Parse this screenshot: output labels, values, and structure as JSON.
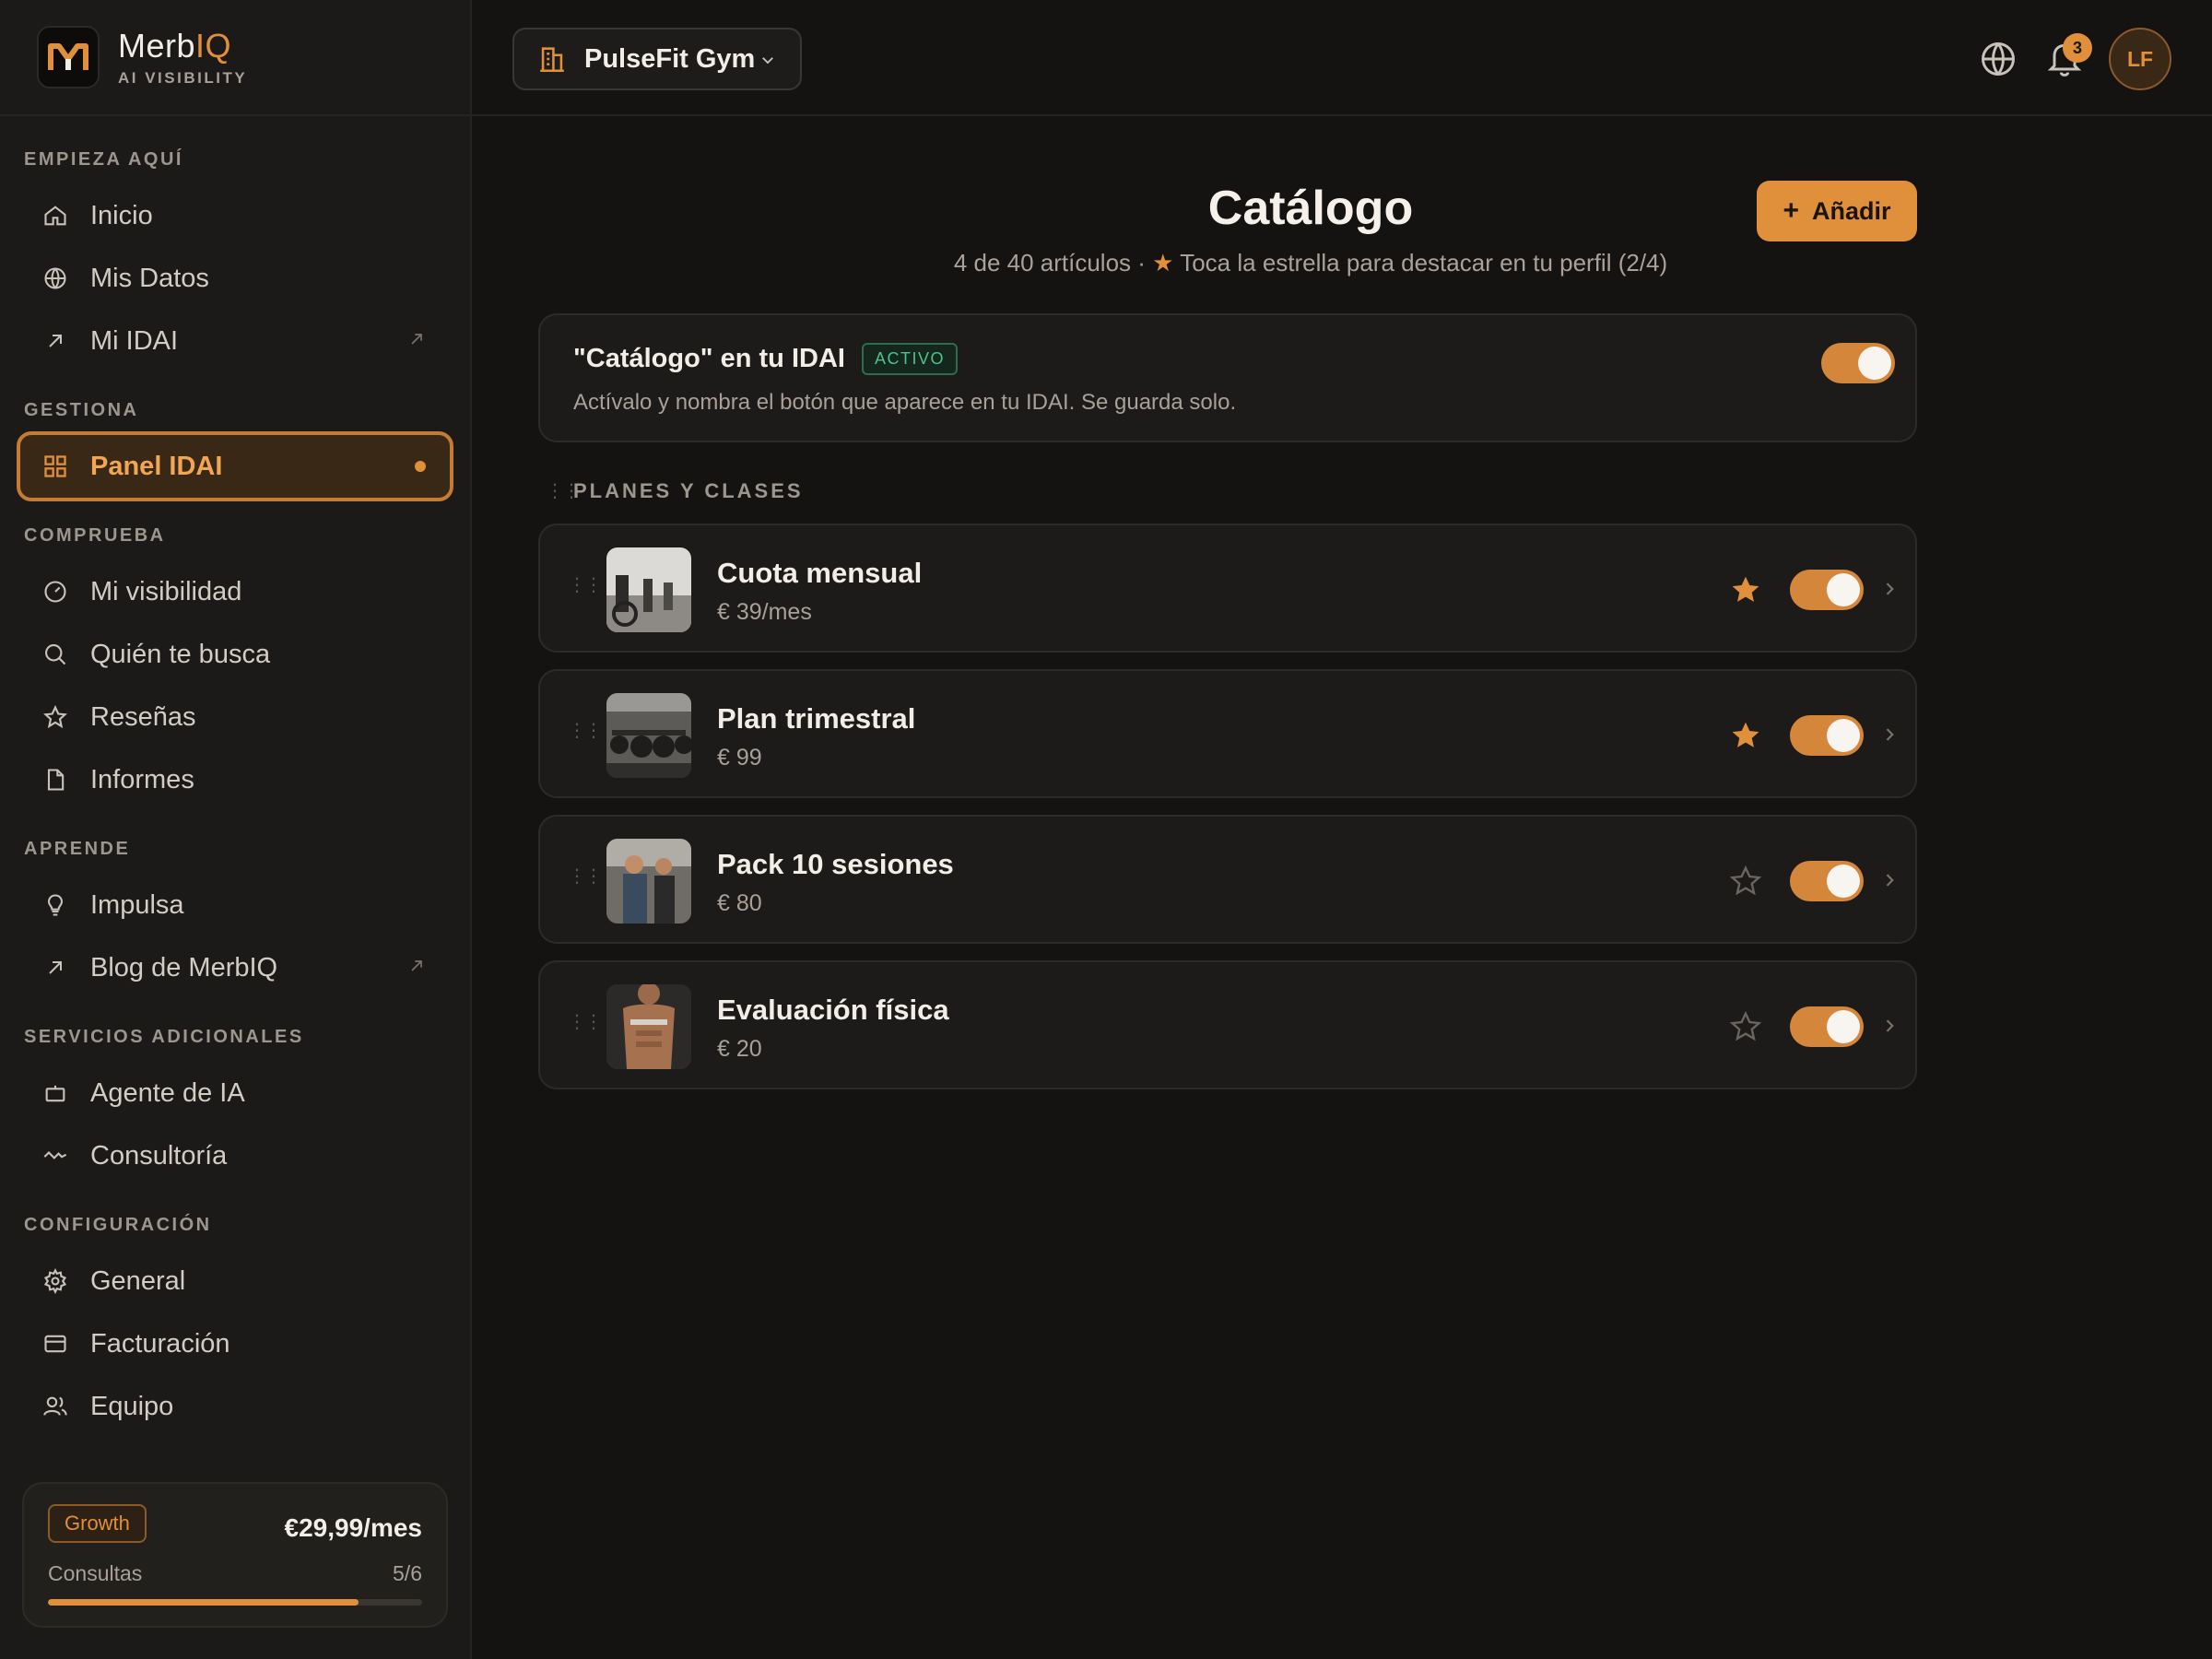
{
  "brand": {
    "name_prefix": "Merb",
    "name_accent": "IQ",
    "subtitle": "AI VISIBILITY"
  },
  "sidebar": {
    "sections": [
      {
        "label": "EMPIEZA AQUÍ"
      },
      {
        "label": "GESTIONA"
      },
      {
        "label": "COMPRUEBA"
      },
      {
        "label": "APRENDE"
      },
      {
        "label": "SERVICIOS ADICIONALES"
      },
      {
        "label": "CONFIGURACIÓN"
      }
    ],
    "items": [
      {
        "label": "Inicio",
        "icon": "home-icon"
      },
      {
        "label": "Mis Datos",
        "icon": "globe-icon"
      },
      {
        "label": "Mi IDAI",
        "icon": "arrow-up-right-icon"
      },
      {
        "label": "Panel IDAI",
        "icon": "grid-icon"
      },
      {
        "label": "Mi visibilidad",
        "icon": "gauge-icon"
      },
      {
        "label": "Quién te busca",
        "icon": "search-icon"
      },
      {
        "label": "Reseñas",
        "icon": "star-icon"
      },
      {
        "label": "Informes",
        "icon": "document-icon"
      },
      {
        "label": "Impulsa",
        "icon": "lightbulb-icon"
      },
      {
        "label": "Blog de MerbIQ",
        "icon": "arrow-up-right-icon"
      },
      {
        "label": "Agente de IA",
        "icon": "bot-icon"
      },
      {
        "label": "Consultoría",
        "icon": "pulse-icon"
      },
      {
        "label": "General",
        "icon": "gear-icon"
      },
      {
        "label": "Facturación",
        "icon": "credit-card-icon"
      },
      {
        "label": "Equipo",
        "icon": "users-icon"
      }
    ],
    "plan": {
      "badge": "Growth",
      "price": "€29,99/mes",
      "usage_label": "Consultas",
      "usage_value": "5/6",
      "usage_fraction": 0.83
    }
  },
  "topbar": {
    "business": "PulseFit Gym",
    "notifications": "3",
    "avatar": "LF"
  },
  "page": {
    "title": "Catálogo",
    "subtitle_count": "4 de 40 artículos · ",
    "subtitle_star": "★",
    "subtitle_hint": " Toca la estrella para destacar en tu perfil (2/4)",
    "add_label": "Añadir"
  },
  "feature": {
    "title": "\"Catálogo\" en tu IDAI",
    "badge": "ACTIVO",
    "description": "Actívalo y nombra el botón que aparece en tu IDAI. Se guarda solo.",
    "enabled": true
  },
  "list": {
    "label": "PLANES Y CLASES",
    "items": [
      {
        "name": "Cuota mensual",
        "price": "€ 39/mes",
        "featured": true,
        "enabled": true
      },
      {
        "name": "Plan trimestral",
        "price": "€ 99",
        "featured": true,
        "enabled": true
      },
      {
        "name": "Pack 10 sesiones",
        "price": "€ 80",
        "featured": false,
        "enabled": true
      },
      {
        "name": "Evaluación física",
        "price": "€ 20",
        "featured": false,
        "enabled": true
      }
    ]
  },
  "colors": {
    "accent": "#e08f3b",
    "background": "#141312",
    "sidebar": "#1b1a18",
    "success": "#4cc38a"
  }
}
